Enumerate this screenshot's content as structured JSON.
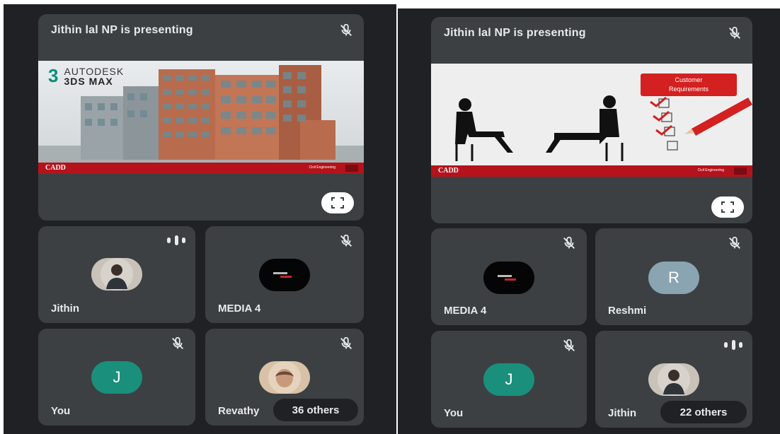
{
  "left": {
    "presenting": "Jithin lal NP is presenting",
    "slide": {
      "logo_number": "3",
      "logo_line1": "AUTODESK",
      "logo_line2": "3DS MAX",
      "footer_logo": "CADD",
      "footer_text": "Civil Engineering"
    },
    "tiles": [
      {
        "name": "Jithin",
        "status": "speaking",
        "avatar": "photo"
      },
      {
        "name": "MEDIA 4",
        "status": "muted",
        "avatar": "logo"
      },
      {
        "name": "You",
        "status": "muted",
        "avatar": "letter",
        "letter": "J"
      },
      {
        "name": "Revathy",
        "status": "muted",
        "avatar": "photo"
      }
    ],
    "others": "36 others"
  },
  "right": {
    "presenting": "Jithin lal NP is presenting",
    "slide": {
      "box_line1": "Customer",
      "box_line2": "Requirements",
      "footer_logo": "CADD",
      "footer_text": "Civil Engineering"
    },
    "tiles": [
      {
        "name": "MEDIA 4",
        "status": "muted",
        "avatar": "logo"
      },
      {
        "name": "Reshmi",
        "status": "muted",
        "avatar": "letter",
        "letter": "R"
      },
      {
        "name": "You",
        "status": "muted",
        "avatar": "letter",
        "letter": "J"
      },
      {
        "name": "Jithin",
        "status": "speaking",
        "avatar": "photo"
      }
    ],
    "others": "22 others"
  },
  "icons": {
    "mic_off": "mic-off-icon",
    "speaking": "audio-level-icon",
    "fullscreen": "fullscreen-icon"
  },
  "colors": {
    "background": "#202124",
    "tile": "#3c4043",
    "you_avatar": "#1a8f7b",
    "reshmi_avatar": "#8aa4b1",
    "slide_footer": "#b5121b"
  }
}
